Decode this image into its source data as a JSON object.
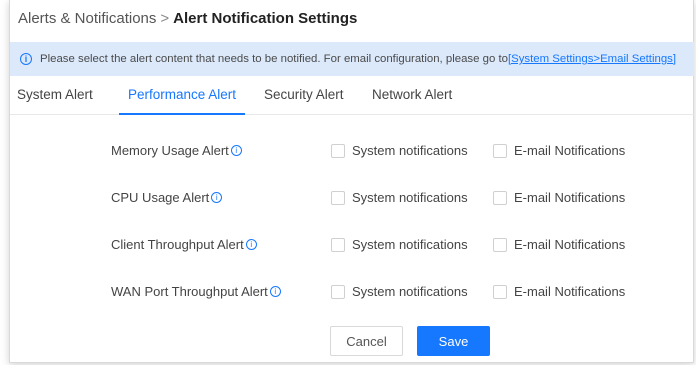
{
  "breadcrumb": {
    "parent": "Alerts & Notifications",
    "separator": ">",
    "current": "Alert Notification Settings"
  },
  "info": {
    "icon": "info-icon",
    "text": "Please select the alert content that needs to be notified. For email configuration, please go to ",
    "link": "[System Settings>Email Settings]"
  },
  "tabs": [
    {
      "label": "System Alert",
      "active": false
    },
    {
      "label": "Performance Alert",
      "active": true
    },
    {
      "label": "Security Alert",
      "active": false
    },
    {
      "label": "Network Alert",
      "active": false
    }
  ],
  "alerts": [
    {
      "label": "Memory Usage Alert",
      "system_label": "System notifications",
      "email_label": "E-mail Notifications",
      "system_checked": false,
      "email_checked": false
    },
    {
      "label": "CPU Usage Alert",
      "system_label": "System notifications",
      "email_label": "E-mail Notifications",
      "system_checked": false,
      "email_checked": false
    },
    {
      "label": "Client Throughput Alert",
      "system_label": "System notifications",
      "email_label": "E-mail Notifications",
      "system_checked": false,
      "email_checked": false
    },
    {
      "label": "WAN Port Throughput Alert",
      "system_label": "System notifications",
      "email_label": "E-mail Notifications",
      "system_checked": false,
      "email_checked": false
    }
  ],
  "buttons": {
    "cancel": "Cancel",
    "save": "Save"
  },
  "colors": {
    "accent": "#1677ff",
    "info_bg": "#dbe9fb"
  }
}
